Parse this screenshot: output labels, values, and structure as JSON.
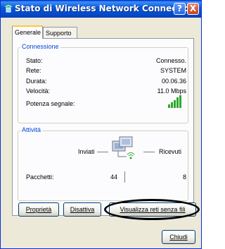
{
  "window": {
    "title": "Stato di Wireless Network Connection",
    "help_label": "?",
    "close_label": "X"
  },
  "tabs": [
    {
      "label": "Generale",
      "active": true
    },
    {
      "label": "Supporto",
      "active": false
    }
  ],
  "connection": {
    "group_label": "Connessione",
    "rows": [
      {
        "label": "Stato:",
        "value": "Connesso."
      },
      {
        "label": "Rete:",
        "value": "SYSTEM"
      },
      {
        "label": "Durata:",
        "value": "00.06.36"
      },
      {
        "label": "Velocità:",
        "value": "11.0 Mbps"
      },
      {
        "label": "Potenza segnale:",
        "value": ""
      }
    ],
    "signal_bars_active": 5,
    "signal_bars_total": 5
  },
  "activity": {
    "group_label": "Attività",
    "sent_label": "Inviati",
    "received_label": "Ricevuti",
    "packets_label": "Pacchetti:",
    "packets_sent": "44",
    "packets_received": "8"
  },
  "buttons": {
    "properties": "Proprietà",
    "disable": "Disattiva",
    "view_networks": "Visualizza reti senza fili",
    "close": "Chiudi"
  },
  "colors": {
    "titlebar": "#0a58d6",
    "group_label": "#0046d5",
    "signal_green": "#2fa82f"
  }
}
